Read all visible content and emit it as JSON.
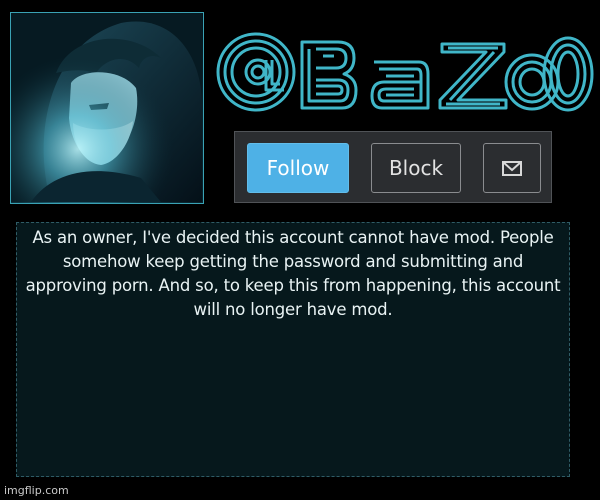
{
  "profile": {
    "username": "@Bazoo",
    "avatar_icon": "hooded-character-avatar"
  },
  "actions": {
    "follow_label": "Follow",
    "block_label": "Block",
    "message_icon": "envelope-icon"
  },
  "announcement": {
    "text": "As an owner, I've decided this account cannot have mod. People somehow keep getting the password and submitting and approving porn. And so, to keep this from happening, this account will no longer have mod."
  },
  "watermark": {
    "text": "imgflip.com"
  },
  "colors": {
    "background": "#000000",
    "accent_teal": "#3aa2b4",
    "follow_blue": "#4eb1e6",
    "panel_bg": "#06181c",
    "button_bar": "#2b2d30"
  }
}
